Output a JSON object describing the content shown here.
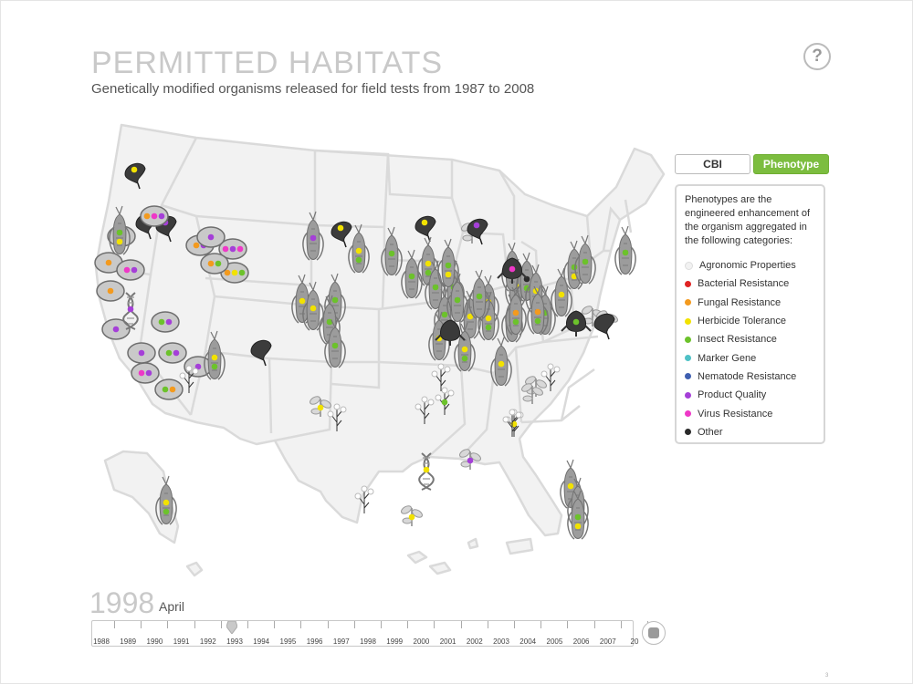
{
  "header": {
    "title": "PERMITTED HABITATS",
    "subtitle": "Genetically modified organisms released for field tests from 1987 to 2008",
    "help_label": "?"
  },
  "view_toggle": {
    "cbi_label": "CBI",
    "phenotype_label": "Phenotype",
    "selected": "Phenotype"
  },
  "legend": {
    "description": "Phenotypes are the engineered enhancement of the organism aggregated in the following categories:",
    "items": [
      {
        "label": "Agronomic Properties",
        "color": "#f2f2f2"
      },
      {
        "label": "Bacterial Resistance",
        "color": "#e02424"
      },
      {
        "label": "Fungal Resistance",
        "color": "#f39a1e"
      },
      {
        "label": "Herbicide Tolerance",
        "color": "#f2e200"
      },
      {
        "label": "Insect Resistance",
        "color": "#6cc22b"
      },
      {
        "label": "Marker Gene",
        "color": "#4fc1c6"
      },
      {
        "label": "Nematode Resistance",
        "color": "#3f5fb0"
      },
      {
        "label": "Product Quality",
        "color": "#a53fd8"
      },
      {
        "label": "Virus Resistance",
        "color": "#ee38c7"
      },
      {
        "label": "Other",
        "color": "#2a2a2a"
      }
    ]
  },
  "date": {
    "year": "1998",
    "month": "April"
  },
  "timeline": {
    "years": [
      "1988",
      "1989",
      "1990",
      "1991",
      "1992",
      "1993",
      "1994",
      "1995",
      "1996",
      "1997",
      "1998",
      "1999",
      "2000",
      "2001",
      "2002",
      "2003",
      "2004",
      "2005",
      "2006",
      "2007",
      "20"
    ]
  },
  "colors": {
    "map_fill": "#f2f2f2",
    "map_stroke": "#dadada",
    "organism": "#9c9c9c",
    "accent": "#7cbd3f"
  },
  "map_markers": [
    {
      "type": "fungus",
      "colors": [
        "#f2e200"
      ]
    },
    {
      "type": "potato",
      "colors": [
        "#ee38c7"
      ]
    },
    {
      "type": "fungus",
      "colors": [
        "#f2e200"
      ]
    },
    {
      "type": "fungus",
      "colors": [
        "#a53fd8"
      ]
    },
    {
      "type": "potato",
      "colors": [
        "#f39a1e"
      ]
    },
    {
      "type": "potato",
      "colors": [
        "#ee38c7",
        "#a53fd8"
      ]
    },
    {
      "type": "potato",
      "colors": [
        "#f39a1e"
      ]
    },
    {
      "type": "potato",
      "colors": [
        "#a53fd8"
      ]
    },
    {
      "type": "potato",
      "colors": [
        "#ee38c7",
        "#a53fd8"
      ]
    },
    {
      "type": "potato",
      "colors": [
        "#6cc22b",
        "#f39a1e"
      ]
    },
    {
      "type": "potato",
      "colors": [
        "#ee38c7",
        "#a53fd8",
        "#ee38c7"
      ]
    },
    {
      "type": "potato",
      "colors": [
        "#f39a1e",
        "#f2e200",
        "#6cc22b"
      ]
    },
    {
      "type": "potato",
      "colors": [
        "#f39a1e",
        "#a53fd8"
      ]
    },
    {
      "type": "potato",
      "colors": [
        "#f39a1e",
        "#6cc22b"
      ]
    },
    {
      "type": "potato",
      "colors": [
        "#a53fd8"
      ]
    },
    {
      "type": "potato",
      "colors": [
        "#f39a1e",
        "#ee38c7",
        "#a53fd8"
      ]
    },
    {
      "type": "potato",
      "colors": [
        "#6cc22b",
        "#a53fd8"
      ]
    },
    {
      "type": "potato",
      "colors": [
        "#a53fd8"
      ]
    },
    {
      "type": "potato",
      "colors": [
        "#6cc22b",
        "#a53fd8"
      ]
    },
    {
      "type": "potato",
      "colors": [
        "#a53fd8"
      ]
    },
    {
      "type": "dna",
      "colors": [
        "#a53fd8"
      ]
    },
    {
      "type": "dna",
      "colors": [
        "#f2e200"
      ]
    },
    {
      "type": "cotton",
      "colors": []
    },
    {
      "type": "cotton",
      "colors": [
        "#6cc22b"
      ]
    },
    {
      "type": "cotton",
      "colors": []
    },
    {
      "type": "cotton",
      "colors": []
    },
    {
      "type": "cotton",
      "colors": []
    },
    {
      "type": "cotton",
      "colors": [
        "#f2e200"
      ]
    },
    {
      "type": "cotton",
      "colors": []
    },
    {
      "type": "cotton",
      "colors": []
    },
    {
      "type": "cotton",
      "colors": []
    },
    {
      "type": "sprout",
      "colors": []
    },
    {
      "type": "sprout",
      "colors": [
        "#a53fd8"
      ]
    },
    {
      "type": "sprout",
      "colors": [
        "#f2e200"
      ]
    },
    {
      "type": "sprout",
      "colors": [
        "#f2e200"
      ]
    },
    {
      "type": "sprout",
      "colors": []
    },
    {
      "type": "sprout",
      "colors": [
        "#a53fd8"
      ]
    },
    {
      "type": "sprout",
      "colors": []
    },
    {
      "type": "sprout",
      "colors": []
    },
    {
      "type": "fungus",
      "colors": [
        "#f2e200"
      ]
    },
    {
      "type": "fungus",
      "colors": []
    },
    {
      "type": "fungus",
      "colors": []
    },
    {
      "type": "fungus",
      "colors": [
        "#a53fd8"
      ]
    },
    {
      "type": "fungus",
      "colors": [
        "#f2e200"
      ]
    },
    {
      "type": "corn",
      "colors": [
        "#a53fd8"
      ]
    },
    {
      "type": "corn",
      "colors": [
        "#f2e200",
        "#6cc22b"
      ]
    },
    {
      "type": "corn",
      "colors": [
        "#6cc22b"
      ]
    },
    {
      "type": "corn",
      "colors": [
        "#6cc22b"
      ]
    },
    {
      "type": "corn",
      "colors": [
        "#f2e200",
        "#6cc22b"
      ]
    },
    {
      "type": "corn",
      "colors": [
        "#6cc22b"
      ]
    },
    {
      "type": "corn",
      "colors": [
        "#6cc22b",
        "#f2e200"
      ]
    },
    {
      "type": "corn",
      "colors": [
        "#f2e200"
      ]
    },
    {
      "type": "corn",
      "colors": [
        "#6cc22b"
      ]
    },
    {
      "type": "corn",
      "colors": [
        "#f2e200",
        "#6cc22b"
      ]
    },
    {
      "type": "corn",
      "colors": [
        "#6cc22b",
        "#f2e200"
      ]
    },
    {
      "type": "corn",
      "colors": [
        "#f2e200"
      ]
    },
    {
      "type": "corn",
      "colors": [
        "#6cc22b"
      ]
    },
    {
      "type": "corn",
      "colors": [
        "#f2e200"
      ]
    },
    {
      "type": "corn",
      "colors": [
        "#f2e200",
        "#6cc22b"
      ]
    },
    {
      "type": "corn",
      "colors": [
        "#6cc22b"
      ]
    },
    {
      "type": "corn",
      "colors": [
        "#f2e200"
      ]
    },
    {
      "type": "corn",
      "colors": [
        "#6cc22b"
      ]
    },
    {
      "type": "corn",
      "colors": [
        "#f2e200"
      ]
    },
    {
      "type": "corn",
      "colors": [
        "#2a2a2a",
        "#6cc22b"
      ]
    },
    {
      "type": "corn",
      "colors": [
        "#f2e200",
        "#6cc22b"
      ]
    },
    {
      "type": "corn",
      "colors": [
        "#f39a1e",
        "#6cc22b"
      ]
    },
    {
      "type": "corn",
      "colors": [
        "#6cc22b"
      ]
    },
    {
      "type": "corn",
      "colors": [
        "#f2e200"
      ]
    },
    {
      "type": "corn",
      "colors": [
        "#6cc22b",
        "#f2e200"
      ]
    },
    {
      "type": "corn",
      "colors": [
        "#6cc22b"
      ]
    },
    {
      "type": "corn",
      "colors": [
        "#6cc22b"
      ]
    },
    {
      "type": "corn",
      "colors": [
        "#f39a1e",
        "#6cc22b"
      ]
    },
    {
      "type": "corn",
      "colors": [
        "#f2e200"
      ]
    },
    {
      "type": "corn",
      "colors": [
        "#6cc22b"
      ]
    },
    {
      "type": "corn",
      "colors": [
        "#f2e200"
      ]
    },
    {
      "type": "corn",
      "colors": [
        "#6cc22b"
      ]
    },
    {
      "type": "corn",
      "colors": [
        "#6cc22b"
      ]
    },
    {
      "type": "corn",
      "colors": [
        "#f2e200",
        "#6cc22b"
      ]
    },
    {
      "type": "corn",
      "colors": [
        "#f2e200",
        "#6cc22b"
      ]
    },
    {
      "type": "corn",
      "colors": [
        "#f2e200"
      ]
    },
    {
      "type": "corn",
      "colors": [
        "#f2e200"
      ]
    },
    {
      "type": "corn",
      "colors": [
        "#6cc22b",
        "#f2e200"
      ]
    },
    {
      "type": "corn",
      "colors": [
        "#f2e200"
      ]
    },
    {
      "type": "corn",
      "colors": [
        "#6cc22b",
        "#f2e200"
      ]
    },
    {
      "type": "dark-plant",
      "colors": [
        "#ee38c7"
      ]
    },
    {
      "type": "dark-plant",
      "colors": []
    },
    {
      "type": "dark-plant",
      "colors": [
        "#6cc22b"
      ]
    },
    {
      "type": "dark-plant",
      "colors": []
    }
  ]
}
